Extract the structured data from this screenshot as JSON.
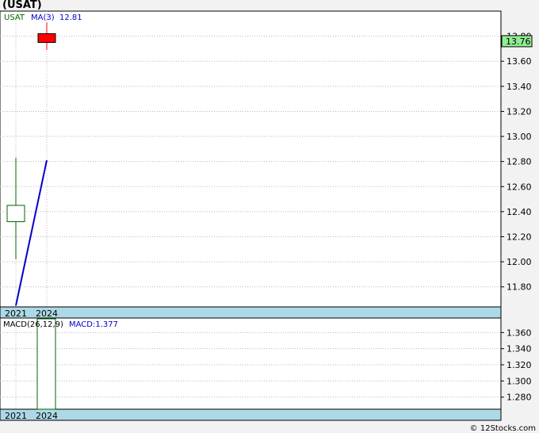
{
  "title": "(USAT)",
  "credit": "© 12Stocks.com",
  "colors": {
    "background": "#f2f2f2",
    "panel": "#ffffff",
    "grid": "#b8b8b8",
    "axis_band": "#add8e6",
    "up_candle": "#006400",
    "down_candle": "#ff0000",
    "ma_line": "#0000cc",
    "last_price_box": "#90ee90",
    "macd_bar": "#006400"
  },
  "chart_data": [
    {
      "type": "candlestick",
      "ticker_label": "USAT",
      "ma_label": "MA(3)",
      "ma_value": "12.81",
      "last_price": "13.76",
      "x_categories": [
        "2021",
        "2024"
      ],
      "ylim": [
        11.64,
        14.0
      ],
      "y_ticks": [
        11.8,
        12.0,
        12.2,
        12.4,
        12.6,
        12.8,
        13.0,
        13.2,
        13.4,
        13.6,
        13.8
      ],
      "y_tick_labels": [
        "11.80",
        "12.00",
        "12.20",
        "12.40",
        "12.60",
        "12.80",
        "13.00",
        "13.20",
        "13.40",
        "13.60",
        "13.80"
      ],
      "candles": [
        {
          "x": "2021",
          "open": 12.32,
          "high": 12.83,
          "low": 12.02,
          "close": 12.45
        },
        {
          "x": "2024",
          "open": 13.82,
          "high": 13.91,
          "low": 13.69,
          "close": 13.75
        }
      ],
      "ma_series": [
        {
          "x": "2021",
          "y": 11.65
        },
        {
          "x": "2024",
          "y": 12.81
        }
      ]
    },
    {
      "type": "bar",
      "indicator_label": "MACD(26,12,9)",
      "macd_label": "MACD:1.377",
      "x_categories": [
        "2021",
        "2024"
      ],
      "ylim": [
        1.265,
        1.378
      ],
      "y_ticks": [
        1.28,
        1.3,
        1.32,
        1.34,
        1.36
      ],
      "y_tick_labels": [
        "1.280",
        "1.300",
        "1.320",
        "1.340",
        "1.360"
      ],
      "bars": [
        {
          "x": "2024",
          "value": 1.377
        }
      ]
    }
  ]
}
